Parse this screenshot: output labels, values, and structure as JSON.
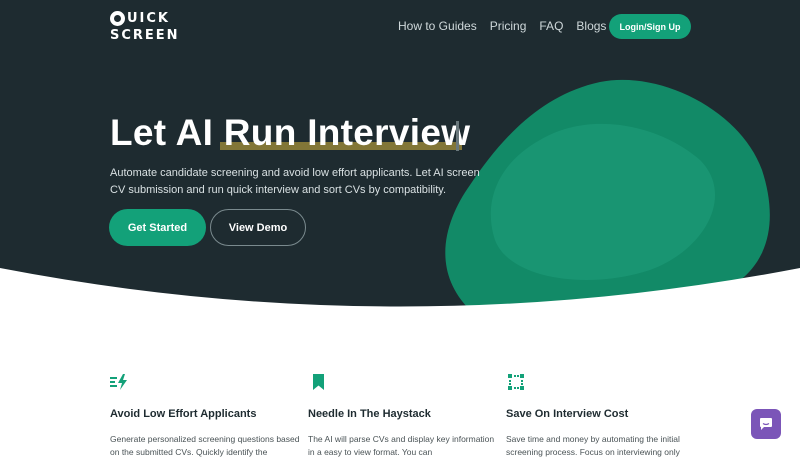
{
  "brand": {
    "logo_line1": "UICK",
    "logo_line2": "SCREEN"
  },
  "nav": {
    "items": [
      {
        "label": "How to Guides"
      },
      {
        "label": "Pricing"
      },
      {
        "label": "FAQ"
      },
      {
        "label": "Blogs"
      }
    ],
    "login_label": "Login/Sign Up"
  },
  "hero": {
    "title": "Let AI Run Interview",
    "subtitle": "Automate candidate screening and avoid low effort applicants. Let AI screen CV submission and run quick interview and sort CVs by compatibility.",
    "primary_cta": "Get Started",
    "secondary_cta": "View Demo"
  },
  "features": [
    {
      "icon": "lightning-bolt-icon",
      "title": "Avoid Low Effort Applicants",
      "text": "Generate personalized screening questions based on the submitted CVs. Quickly identify the"
    },
    {
      "icon": "bookmark-icon",
      "title": "Needle In The Haystack",
      "text": "The AI will parse CVs and display key information in a easy to view format. You can"
    },
    {
      "icon": "dotted-frame-icon",
      "title": "Save On Interview Cost",
      "text": "Save time and money by automating the initial screening process. Focus on interviewing only"
    }
  ],
  "colors": {
    "hero_bg": "#1e2b30",
    "accent": "#13a179",
    "chat": "#7b55b8"
  }
}
